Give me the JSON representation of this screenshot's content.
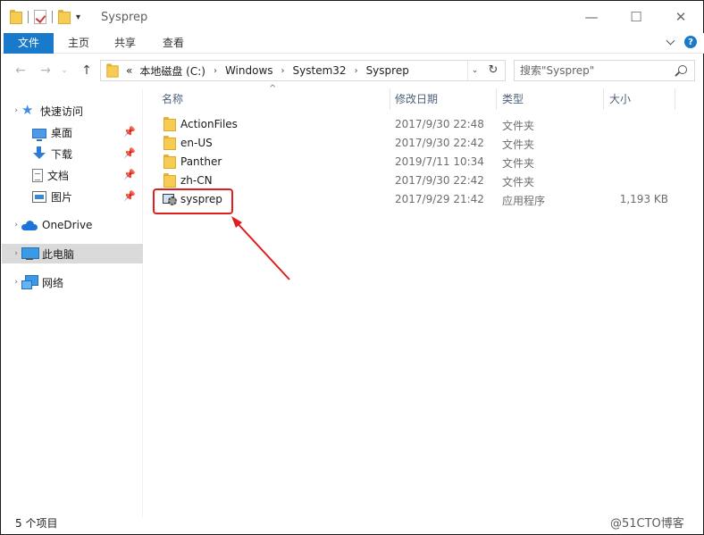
{
  "window": {
    "title": "Sysprep",
    "controls": {
      "minimize": "—",
      "maximize": "☐",
      "close": "✕"
    }
  },
  "ribbon": {
    "tabs": [
      "文件",
      "主页",
      "共享",
      "查看"
    ],
    "help": "?"
  },
  "address": {
    "overflow": "«",
    "separator": "›",
    "crumbs": [
      "本地磁盘 (C:)",
      "Windows",
      "System32",
      "Sysprep"
    ],
    "dropdown": "⌄",
    "refresh": "↻"
  },
  "search": {
    "placeholder": "搜索\"Sysprep\""
  },
  "sidebar": {
    "items": [
      {
        "label": "快速访问",
        "icon": "star-icon"
      },
      {
        "label": "桌面",
        "icon": "desktop-icon"
      },
      {
        "label": "下载",
        "icon": "download-icon"
      },
      {
        "label": "文档",
        "icon": "document-icon"
      },
      {
        "label": "图片",
        "icon": "picture-icon"
      },
      {
        "label": "OneDrive",
        "icon": "cloud-icon"
      },
      {
        "label": "此电脑",
        "icon": "pc-icon"
      },
      {
        "label": "网络",
        "icon": "network-icon"
      }
    ],
    "pin": "📌",
    "expand": "›"
  },
  "columns": {
    "name": "名称",
    "date": "修改日期",
    "type": "类型",
    "size": "大小",
    "sort": "^"
  },
  "files": [
    {
      "name": "ActionFiles",
      "date": "2017/9/30 22:48",
      "type": "文件夹",
      "size": "",
      "icon": "folder-icon"
    },
    {
      "name": "en-US",
      "date": "2017/9/30 22:42",
      "type": "文件夹",
      "size": "",
      "icon": "folder-icon"
    },
    {
      "name": "Panther",
      "date": "2019/7/11 10:34",
      "type": "文件夹",
      "size": "",
      "icon": "folder-icon"
    },
    {
      "name": "zh-CN",
      "date": "2017/9/30 22:42",
      "type": "文件夹",
      "size": "",
      "icon": "folder-icon"
    },
    {
      "name": "sysprep",
      "date": "2017/9/29 21:42",
      "type": "应用程序",
      "size": "1,193 KB",
      "icon": "app-icon"
    }
  ],
  "status": {
    "item_count": "5 个项目"
  },
  "watermark": "@51CTO博客",
  "colors": {
    "accent": "#1979ca",
    "highlight": "#e01e1e",
    "folder": "#f6cd52"
  }
}
